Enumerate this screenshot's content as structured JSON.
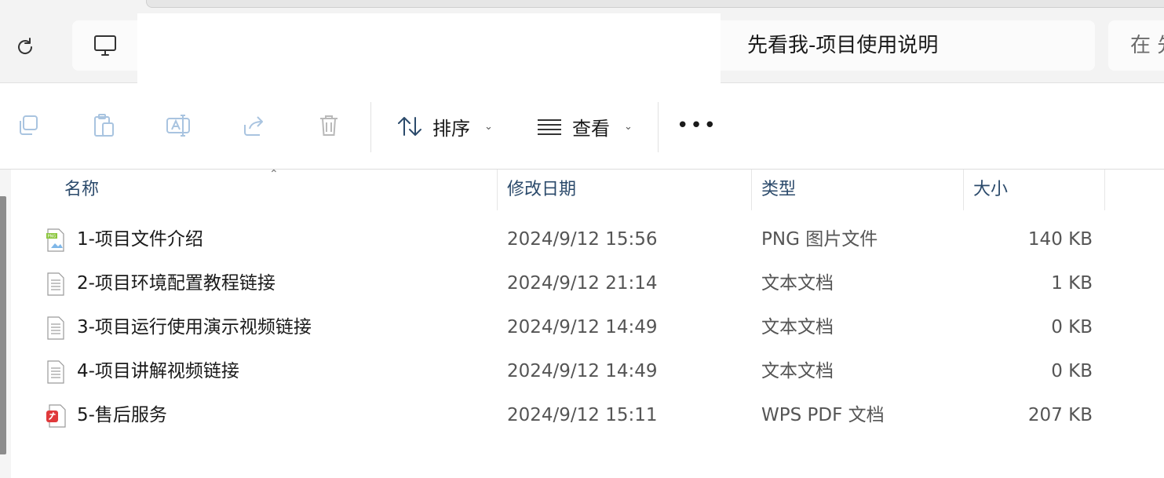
{
  "address": {
    "path_text": "先看我-项目使用说明",
    "search_placeholder": "在 先"
  },
  "toolbar": {
    "sort_label": "排序",
    "view_label": "查看"
  },
  "columns": {
    "name": "名称",
    "modified": "修改日期",
    "type": "类型",
    "size": "大小"
  },
  "files": [
    {
      "name": "1-项目文件介绍",
      "date": "2024/9/12 15:56",
      "type": "PNG 图片文件",
      "size": "140 KB",
      "icon": "png-file-icon"
    },
    {
      "name": "2-项目环境配置教程链接",
      "date": "2024/9/12 21:14",
      "type": "文本文档",
      "size": "1 KB",
      "icon": "text-file-icon"
    },
    {
      "name": "3-项目运行使用演示视频链接",
      "date": "2024/9/12 14:49",
      "type": "文本文档",
      "size": "0 KB",
      "icon": "text-file-icon"
    },
    {
      "name": "4-项目讲解视频链接",
      "date": "2024/9/12 14:49",
      "type": "文本文档",
      "size": "0 KB",
      "icon": "text-file-icon"
    },
    {
      "name": "5-售后服务",
      "date": "2024/9/12 15:11",
      "type": "WPS PDF 文档",
      "size": "207 KB",
      "icon": "pdf-file-icon"
    }
  ],
  "colors": {
    "accent": "#2b4a6b",
    "disabled_icon": "#a9c4e0",
    "pdf_red": "#e0393b",
    "png_green": "#8cc63f"
  }
}
